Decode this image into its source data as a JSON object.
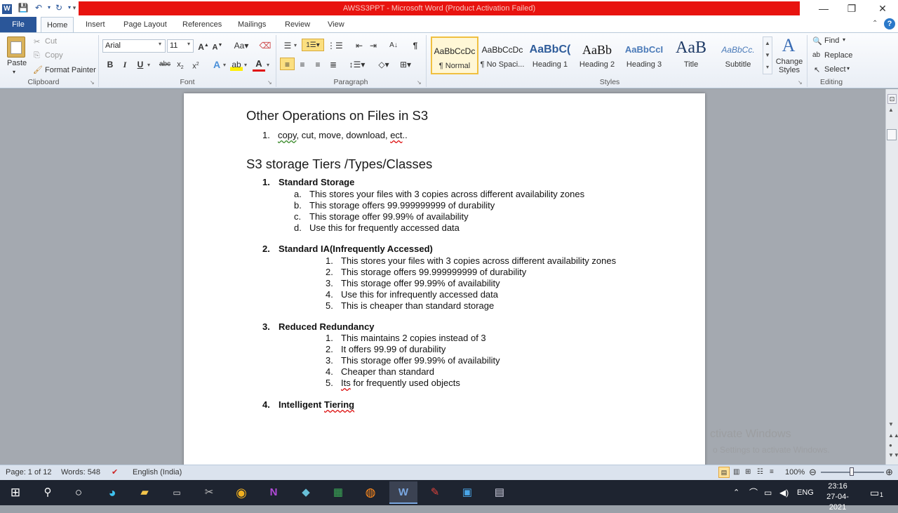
{
  "window": {
    "title": "AWSS3PPT  -  Microsoft Word (Product Activation Failed)",
    "app_icon": "W"
  },
  "tabs": [
    "File",
    "Home",
    "Insert",
    "Page Layout",
    "References",
    "Mailings",
    "Review",
    "View"
  ],
  "clipboard": {
    "paste": "Paste",
    "cut": "Cut",
    "copy": "Copy",
    "format_painter": "Format Painter",
    "label": "Clipboard"
  },
  "font": {
    "name": "Arial",
    "size": "11",
    "label": "Font"
  },
  "paragraph": {
    "label": "Paragraph"
  },
  "styles": {
    "label": "Styles",
    "items": [
      {
        "sample": "AaBbCcDc",
        "name": "¶ Normal"
      },
      {
        "sample": "AaBbCcDc",
        "name": "¶ No Spaci..."
      },
      {
        "sample": "AaBbC(",
        "name": "Heading 1"
      },
      {
        "sample": "AaBb",
        "name": "Heading 2"
      },
      {
        "sample": "AaBbCcI",
        "name": "Heading 3"
      },
      {
        "sample": "AaB",
        "name": "Title"
      },
      {
        "sample": "AaBbCc.",
        "name": "Subtitle"
      }
    ],
    "change_styles": "Change Styles"
  },
  "editing": {
    "find": "Find",
    "replace": "Replace",
    "select": "Select",
    "label": "Editing"
  },
  "document": {
    "heading1": "Other Operations on Files in S3",
    "ops_num": "1.",
    "ops_text_a": "copy",
    "ops_text_b": ", cut, move, download, ",
    "ops_text_c": "ect",
    "ops_text_d": "..",
    "heading2": "S3 storage Tiers /Types/Classes",
    "tiers": [
      {
        "num": "1.",
        "title": "Standard Storage",
        "items": [
          {
            "m": "a.",
            "t": "This stores your files with 3 copies across different availability zones"
          },
          {
            "m": "b.",
            "t": "This storage offers 99.999999999  of durability"
          },
          {
            "m": "c.",
            "t": "This storage offer 99.99% of availability"
          },
          {
            "m": "d.",
            "t": "Use this for frequently accessed data"
          }
        ]
      },
      {
        "num": "2.",
        "title": "Standard IA(Infrequently Accessed)",
        "items": [
          {
            "m": "1.",
            "t": "This stores your files with 3 copies across different availability zones"
          },
          {
            "m": "2.",
            "t": "This storage offers 99.999999999  of durability"
          },
          {
            "m": "3.",
            "t": "This storage offer 99.99% of availability"
          },
          {
            "m": "4.",
            "t": "Use this  for infrequently accessed data"
          },
          {
            "m": "5.",
            "t": "This is cheaper than standard storage"
          }
        ]
      },
      {
        "num": "3.",
        "title": "Reduced Redundancy",
        "items": [
          {
            "m": "1.",
            "t": "This maintains 2 copies instead  of 3"
          },
          {
            "m": "2.",
            "t": "It offers 99.99  of durability"
          },
          {
            "m": "3.",
            "t": "This storage offer 99.99% of availability"
          },
          {
            "m": "4.",
            "t": "Cheaper than standard"
          },
          {
            "m": "5.",
            "t_a": "Its",
            "t_b": " for frequently used objects"
          }
        ]
      },
      {
        "num": "4.",
        "title_a": "Intelligent ",
        "title_b": "Tiering"
      }
    ]
  },
  "watermark": {
    "line1": "ctivate Windows",
    "line2": "o Settings to activate Windows."
  },
  "status": {
    "page": "Page: 1 of 12",
    "words": "Words: 548",
    "language": "English (India)",
    "zoom": "100%"
  },
  "tray": {
    "lang": "ENG",
    "time": "23:16",
    "date": "27-04-2021",
    "notif": "1"
  }
}
